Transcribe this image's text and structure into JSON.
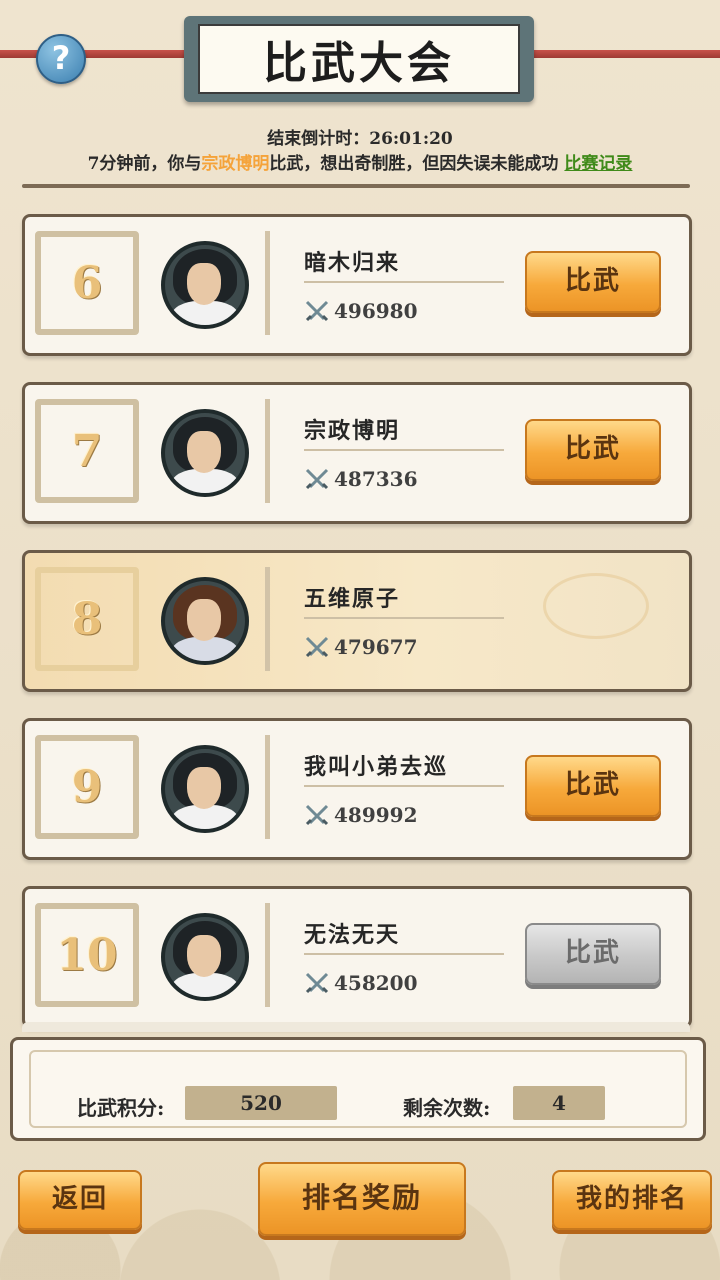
{
  "header": {
    "title": "比武大会",
    "help_label": "?",
    "countdown_label": "结束倒计时：",
    "countdown_value": "26:01:20"
  },
  "notice": {
    "prefix": "7分钟前，你与",
    "opponent": "宗政博明",
    "suffix": "比武，想出奇制胜，但因失误未能成功",
    "record_link": "比赛记录"
  },
  "players": [
    {
      "rank": "6",
      "name": "暗木归来",
      "power": "496980",
      "button": "比武",
      "state": "active"
    },
    {
      "rank": "7",
      "name": "宗政博明",
      "power": "487336",
      "button": "比武",
      "state": "active"
    },
    {
      "rank": "8",
      "name": "五维原子",
      "power": "479677",
      "button": "",
      "state": "self"
    },
    {
      "rank": "9",
      "name": "我叫小弟去巡",
      "power": "489992",
      "button": "比武",
      "state": "active"
    },
    {
      "rank": "10",
      "name": "无法无天",
      "power": "458200",
      "button": "比武",
      "state": "disabled"
    }
  ],
  "stats": {
    "points_label": "比武积分:",
    "points_value": "520",
    "remaining_label": "剩余次数:",
    "remaining_value": "4"
  },
  "bottom": {
    "back": "返回",
    "rewards": "排名奖励",
    "my_rank": "我的排名"
  },
  "colors": {
    "opponent_highlight": "#f5a33a",
    "record_link": "#3f8a19",
    "button_orange": "#f7a93b",
    "button_disabled": "#c8c8c8"
  }
}
